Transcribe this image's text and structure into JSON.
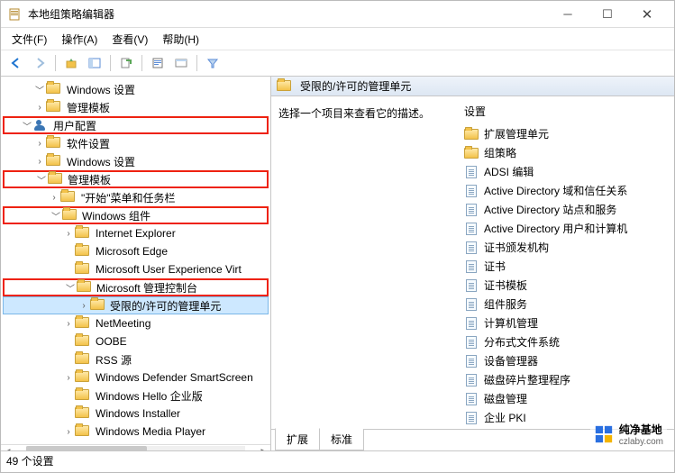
{
  "window": {
    "title": "本地组策略编辑器"
  },
  "menu": {
    "file": "文件(F)",
    "action": "操作(A)",
    "view": "查看(V)",
    "help": "帮助(H)"
  },
  "tree": {
    "win_settings": "Windows 设置",
    "admin_templates_top": "管理模板",
    "user_config": "用户配置",
    "soft_settings": "软件设置",
    "win_settings2": "Windows 设置",
    "admin_templates": "管理模板",
    "start_menu": "\"开始\"菜单和任务栏",
    "win_components": "Windows 组件",
    "ie": "Internet Explorer",
    "edge": "Microsoft Edge",
    "uev": "Microsoft User Experience Virt",
    "mmc": "Microsoft 管理控制台",
    "restricted": "受限的/许可的管理单元",
    "netmeeting": "NetMeeting",
    "oobe": "OOBE",
    "rss": "RSS 源",
    "defender": "Windows Defender SmartScreen",
    "hello": "Windows Hello 企业版",
    "installer": "Windows Installer",
    "wmp": "Windows Media Player"
  },
  "right": {
    "header": "受限的/许可的管理单元",
    "prompt": "选择一个项目来查看它的描述。",
    "col": "设置",
    "items": {
      "ext": "扩展管理单元",
      "gp": "组策略",
      "adsi": "ADSI 编辑",
      "ad1": "Active Directory 域和信任关系",
      "ad2": "Active Directory 站点和服务",
      "ad3": "Active Directory 用户和计算机",
      "ca": "证书颁发机构",
      "cert": "证书",
      "certtpl": "证书模板",
      "comsvc": "组件服务",
      "compmgmt": "计算机管理",
      "dfs": "分布式文件系统",
      "devmgr": "设备管理器",
      "defrag": "磁盘碎片整理程序",
      "diskmgmt": "磁盘管理",
      "pki": "企业 PKI"
    },
    "tabs": {
      "ext": "扩展",
      "std": "标准"
    }
  },
  "status": {
    "text": "49 个设置"
  },
  "watermark": {
    "text": "纯净基地",
    "sub": "czlaby.com"
  }
}
